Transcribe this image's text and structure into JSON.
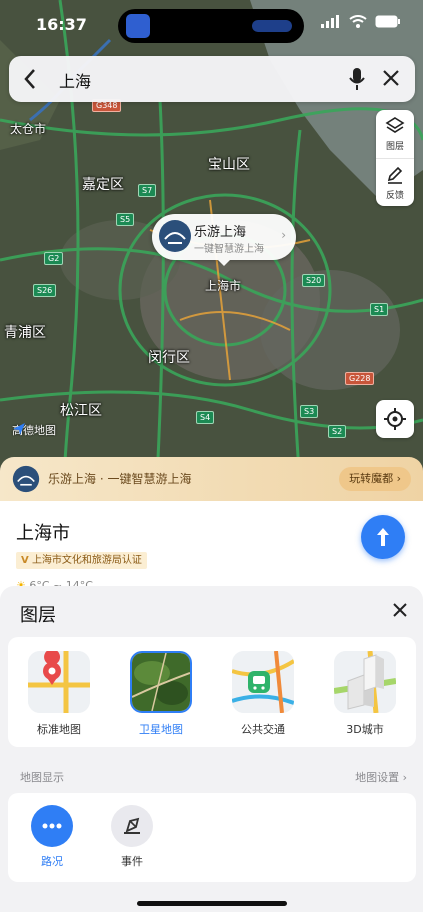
{
  "status_bar": {
    "time": "16:37"
  },
  "search": {
    "query": "上海"
  },
  "map_tools": {
    "layers_label": "图层",
    "feedback_label": "反馈"
  },
  "map_labels": {
    "taicang": "太仓市",
    "jiading": "嘉定区",
    "baoshan": "宝山区",
    "qingpu": "青浦区",
    "minhang": "闵行区",
    "songjiang": "松江区",
    "shanghai_city": "上海市"
  },
  "road_shields": {
    "g348": "G348",
    "s7": "S7",
    "s5": "S5",
    "g2": "G2",
    "s26": "S26",
    "s20": "S20",
    "s1": "S1",
    "g228": "G228",
    "s4": "S4",
    "s3": "S3",
    "s2": "S2"
  },
  "callout": {
    "title": "乐游上海",
    "subtitle": "一键智慧游上海"
  },
  "watermark": "高德地图",
  "banner": {
    "text": "乐游上海 · 一键智慧游上海",
    "button": "玩转魔都"
  },
  "place_card": {
    "city": "上海市",
    "certification": "上海市文化和旅游局认证",
    "weather": "6°C ~ 14°C"
  },
  "layer_sheet": {
    "title": "图层",
    "layers": [
      {
        "label": "标准地图",
        "icon": "standard-map-icon"
      },
      {
        "label": "卫星地图",
        "icon": "satellite-map-icon"
      },
      {
        "label": "公共交通",
        "icon": "transit-icon"
      },
      {
        "label": "3D城市",
        "icon": "3d-city-icon"
      }
    ],
    "selected_layer": "卫星地图",
    "display_section": "地图显示",
    "settings_link": "地图设置",
    "display_options": [
      {
        "label": "路况",
        "icon": "traffic-icon",
        "enabled": true
      },
      {
        "label": "事件",
        "icon": "event-icon",
        "enabled": false
      }
    ]
  },
  "colors": {
    "accent": "#2f7ef5",
    "banner": "#f6e7c9",
    "road_green": "#3aa65a"
  }
}
